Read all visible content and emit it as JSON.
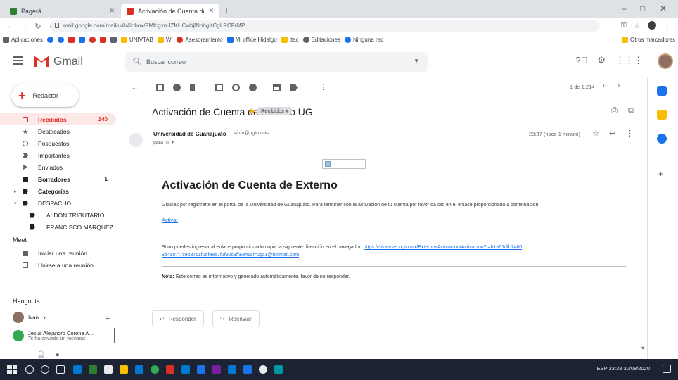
{
  "browser": {
    "tabs": [
      {
        "title": "Pagerá",
        "active": false,
        "color": "#2e7d32"
      },
      {
        "title": "Activación de Cuenta de Extern",
        "active": true,
        "color": "#d93025"
      }
    ],
    "url": "mail.google.com/mail/u/0/#inbox/FMfcgxwJZKHCwbjlNnhgKCgLRCFrMP",
    "bookmarks": [
      "Aplicaciones",
      "",
      "",
      "",
      "",
      "",
      "",
      "",
      "UNIVTAB",
      "Wl",
      "Asesoramiento",
      "Mi office Hidalgo",
      "ttac",
      "Editaciones",
      "Ninguna red"
    ],
    "bookmarks_right": "Otros marcadores"
  },
  "gmail": {
    "logo_text": "Gmail",
    "search_placeholder": "Buscar correo",
    "compose_label": "Redactar",
    "nav": [
      {
        "label": "Recibidos",
        "count": "140",
        "active": true,
        "icon": "inbox-icon"
      },
      {
        "label": "Destacados",
        "count": "",
        "icon": "star-icon"
      },
      {
        "label": "Pospuestos",
        "count": "",
        "icon": "clock-icon"
      },
      {
        "label": "Importantes",
        "count": "",
        "icon": "important-icon"
      },
      {
        "label": "Enviados",
        "count": "",
        "icon": "send-icon"
      },
      {
        "label": "Borradores",
        "count": "1",
        "icon": "draft-icon"
      },
      {
        "label": "Categorías",
        "count": "",
        "icon": "label-icon"
      },
      {
        "label": "DESPACHO",
        "count": "",
        "icon": "label-icon"
      },
      {
        "label": "ALDON TRIBUTARIO",
        "count": "",
        "icon": "label-icon",
        "sub": true
      },
      {
        "label": "FRANCISCO MARQUEZ",
        "count": "",
        "icon": "label-icon",
        "sub": true
      }
    ],
    "meet": {
      "title": "Meet",
      "items": [
        {
          "label": "Iniciar una reunión",
          "icon": "video-icon"
        },
        {
          "label": "Unirse a una reunión",
          "icon": "keyboard-icon"
        }
      ]
    },
    "hangouts": {
      "title": "Hangouts",
      "user": "Ivan",
      "chat_name": "Jesus Alejandro Corona A...",
      "chat_status": "Te ha enviado un mensaje"
    },
    "pager": "1 de 1.214",
    "email": {
      "subject": "Activación de Cuenta de Externo UG",
      "label": "Recibidos x",
      "sender_name": "Universidad de Guanajuato",
      "sender_email": "<info@ugto.mx>",
      "to": "para mí",
      "date": "23:37 (hace 1 minuto)",
      "body_title": "Activación de Cuenta de Externo",
      "body_p1": "Gracias por registrarte en el portal de la Universidad de Guanajuato. Para terminar con la activación de tu cuenta por favor da clic en el enlace proporcionado a continuación:",
      "body_link": "Activar",
      "body_p2": "Si no puedes ingresar al enlace proporcionado copia la siguiente dirección en el navegador:",
      "body_url1": "https://sistemas.ugto.mx/ExternosActivacion/Activacion?t=b1a61dfb7480",
      "body_url2": "3d4a07f7c9b87c1f0dfe8b7f2f92c3ff&email=ugc1@hotmail.com",
      "note_label": "Nota:",
      "note_text": "Este correo es informativo y generado automáticamente. favor de no responder.",
      "reply_label": "Responder",
      "forward_label": "Reenviar"
    }
  },
  "taskbar": {
    "tray_text": "ESP  23:38  30/08/2020"
  }
}
